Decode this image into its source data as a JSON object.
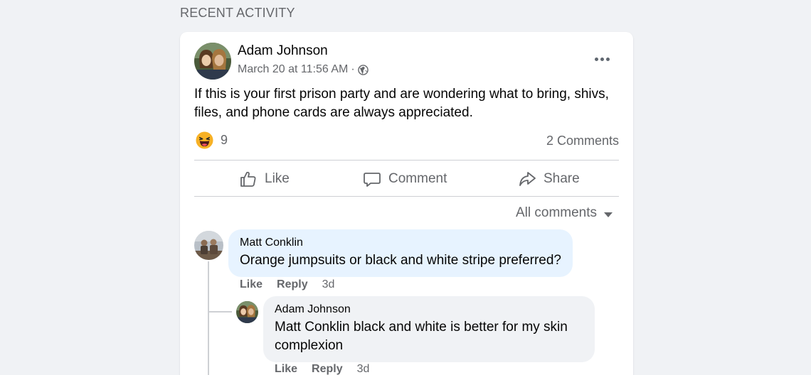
{
  "section": {
    "title": "RECENT ACTIVITY"
  },
  "post": {
    "author": "Adam Johnson",
    "timestamp": "March 20 at 11:56 AM",
    "separator": "·",
    "text": "If this is your first prison party and are wondering what to bring, shivs, files, and phone cards are always appreciated.",
    "reaction_count": "9",
    "comments_label": "2 Comments",
    "actions": {
      "like": "Like",
      "comment": "Comment",
      "share": "Share"
    },
    "all_comments_label": "All comments"
  },
  "comments": [
    {
      "author": "Matt Conklin",
      "text": "Orange jumpsuits or black and white stripe preferred?",
      "like": "Like",
      "reply": "Reply",
      "time": "3d"
    }
  ],
  "reply": {
    "author": "Adam Johnson",
    "mention": "Matt Conklin",
    "text": " black and white is better for my skin complexion",
    "like": "Like",
    "reply": "Reply",
    "time": "3d"
  },
  "colors": {
    "page_bg": "#f0f2f5",
    "card_bg": "#ffffff",
    "bubble_highlight": "#e7f3ff",
    "bubble_default": "#f0f2f5",
    "secondary_text": "#65676b"
  },
  "icons": {
    "privacy": "globe-icon",
    "reaction": "haha-icon",
    "like": "thumbs-up-icon",
    "comment": "speech-bubble-icon",
    "share": "share-arrow-icon",
    "more": "more-dots-icon",
    "sort": "caret-down-icon"
  }
}
